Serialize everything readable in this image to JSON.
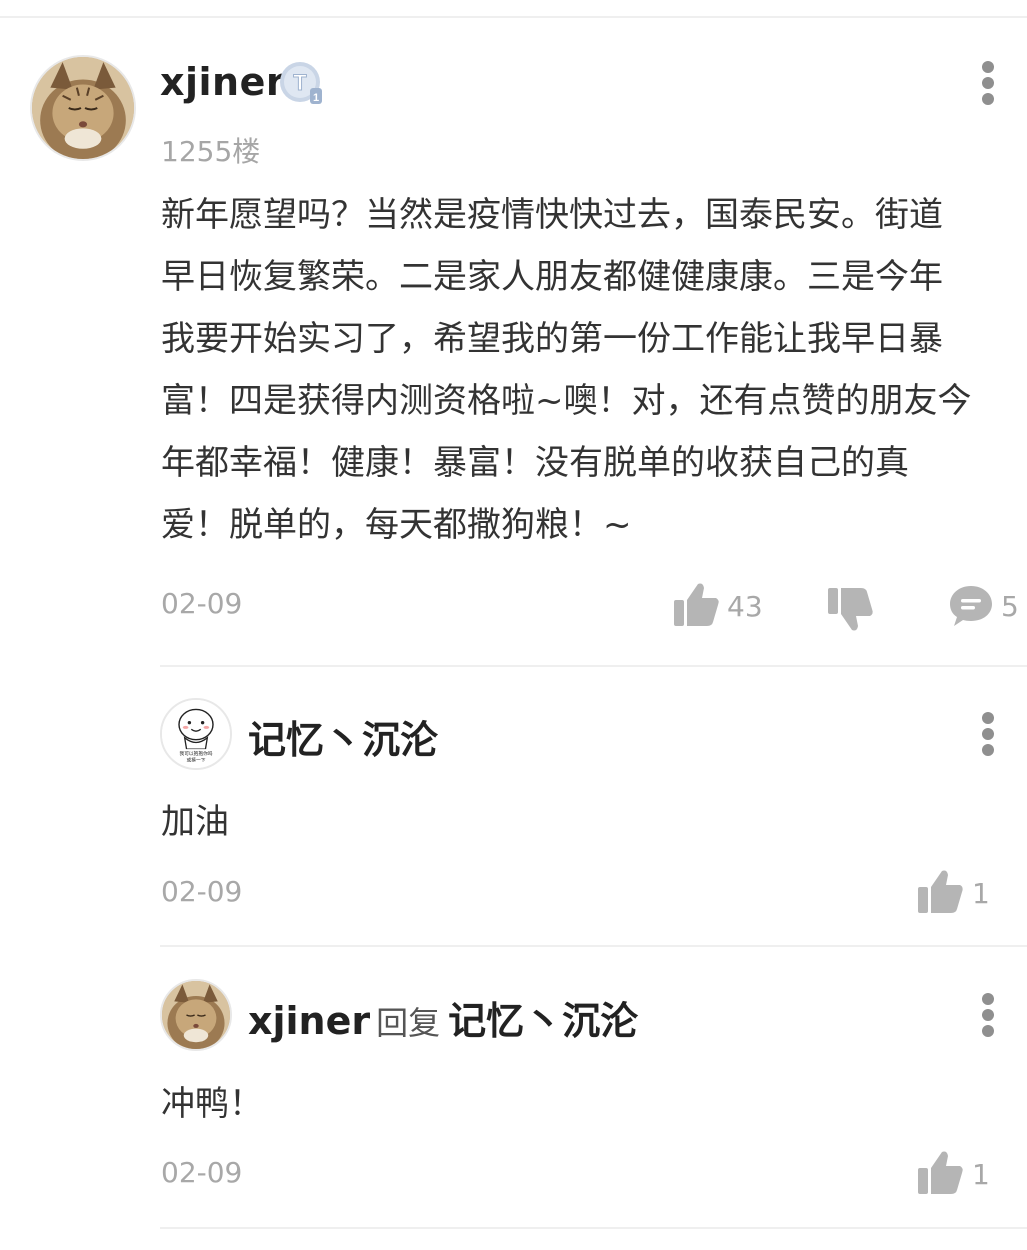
{
  "post": {
    "username": "xjiner",
    "floor": "1255楼",
    "level_badge": "T1",
    "content_lines": [
      "新年愿望吗？当然是疫情快快过去，国泰民安。街道",
      "早日恢复繁荣。二是家人朋友都健健康康。三是今年",
      "我要开始实习了，希望我的第一份工作能让我早日暴",
      "富！四是获得内测资格啦~噢！对，还有点赞的朋友今",
      "年都幸福！健康！暴富！没有脱单的收获自己的真",
      "爱！脱单的，每天都撒狗粮！~"
    ],
    "date": "02-09",
    "like_count": "43",
    "comment_count": "5"
  },
  "replies": [
    {
      "username": "记忆丶沉沦",
      "content": "加油",
      "date": "02-09",
      "like_count": "1"
    },
    {
      "username": "xjiner",
      "reply_word": "回复",
      "reply_to": "记忆丶沉沦",
      "content": "冲鸭！",
      "date": "02-09",
      "like_count": "1"
    }
  ],
  "colors": {
    "text_primary": "#222222",
    "text_secondary": "#a8a8a8",
    "icon_gray": "#b5b5b5",
    "divider": "#efefef",
    "badge_blue": "#9fb3cf"
  }
}
